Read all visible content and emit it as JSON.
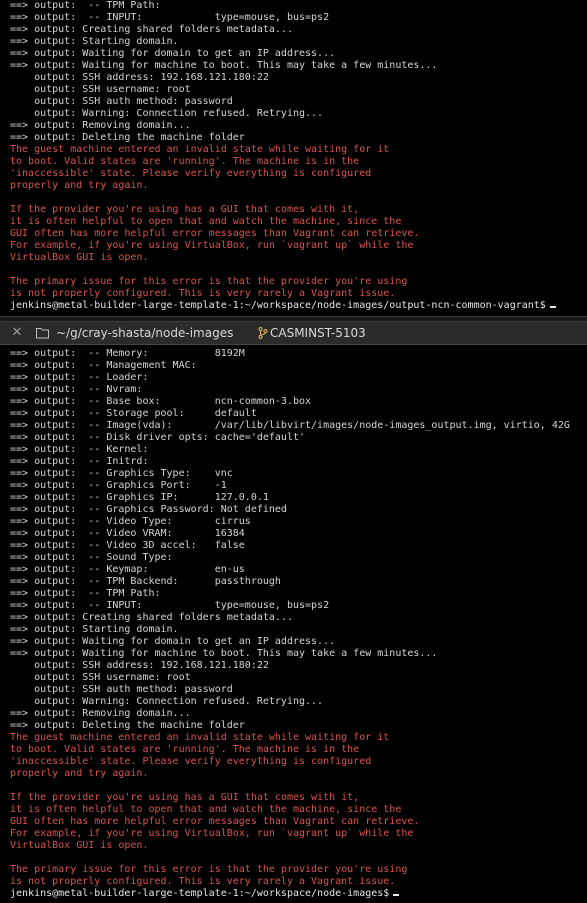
{
  "theme": {
    "background": "#000000",
    "text": "#d4d4d4",
    "error": "#d9534f"
  },
  "tab": {
    "close_icon": "close-icon",
    "folder_icon": "folder-icon",
    "path": "~/g/cray-shasta/node-images",
    "branch_icon": "git-branch-icon",
    "branch": "CASMINST-5103"
  },
  "top_pane": {
    "lines": [
      {
        "text": "==> output:  -- TPM Path:",
        "kind": "out"
      },
      {
        "text": "==> output:  -- INPUT:            type=mouse, bus=ps2",
        "kind": "out"
      },
      {
        "text": "==> output: Creating shared folders metadata...",
        "kind": "out"
      },
      {
        "text": "==> output: Starting domain.",
        "kind": "out"
      },
      {
        "text": "==> output: Waiting for domain to get an IP address...",
        "kind": "out"
      },
      {
        "text": "==> output: Waiting for machine to boot. This may take a few minutes...",
        "kind": "out"
      },
      {
        "text": "    output: SSH address: 192.168.121.180:22",
        "kind": "out"
      },
      {
        "text": "    output: SSH username: root",
        "kind": "out"
      },
      {
        "text": "    output: SSH auth method: password",
        "kind": "out"
      },
      {
        "text": "    output: Warning: Connection refused. Retrying...",
        "kind": "out"
      },
      {
        "text": "==> output: Removing domain...",
        "kind": "out"
      },
      {
        "text": "==> output: Deleting the machine folder",
        "kind": "out"
      },
      {
        "text": "The guest machine entered an invalid state while waiting for it",
        "kind": "err"
      },
      {
        "text": "to boot. Valid states are 'running'. The machine is in the",
        "kind": "err"
      },
      {
        "text": "'inaccessible' state. Please verify everything is configured",
        "kind": "err"
      },
      {
        "text": "properly and try again.",
        "kind": "err"
      },
      {
        "text": "",
        "kind": "err"
      },
      {
        "text": "If the provider you're using has a GUI that comes with it,",
        "kind": "err"
      },
      {
        "text": "it is often helpful to open that and watch the machine, since the",
        "kind": "err"
      },
      {
        "text": "GUI often has more helpful error messages than Vagrant can retrieve.",
        "kind": "err"
      },
      {
        "text": "For example, if you're using VirtualBox, run `vagrant up` while the",
        "kind": "err"
      },
      {
        "text": "VirtualBox GUI is open.",
        "kind": "err"
      },
      {
        "text": "",
        "kind": "err"
      },
      {
        "text": "The primary issue for this error is that the provider you're using",
        "kind": "err"
      },
      {
        "text": "is not properly configured. This is very rarely a Vagrant issue.",
        "kind": "err"
      }
    ],
    "prompt": "jenkins@metal-builder-large-template-1:~/workspace/node-images/output-ncn-common-vagrant$"
  },
  "bottom_pane": {
    "lines": [
      {
        "text": "==> output:  -- Memory:           8192M",
        "kind": "out"
      },
      {
        "text": "==> output:  -- Management MAC:",
        "kind": "out"
      },
      {
        "text": "==> output:  -- Loader:",
        "kind": "out"
      },
      {
        "text": "==> output:  -- Nvram:",
        "kind": "out"
      },
      {
        "text": "==> output:  -- Base box:         ncn-common-3.box",
        "kind": "out"
      },
      {
        "text": "==> output:  -- Storage pool:     default",
        "kind": "out"
      },
      {
        "text": "==> output:  -- Image(vda):       /var/lib/libvirt/images/node-images_output.img, virtio, 42G",
        "kind": "out"
      },
      {
        "text": "==> output:  -- Disk driver opts: cache='default'",
        "kind": "out"
      },
      {
        "text": "==> output:  -- Kernel:",
        "kind": "out"
      },
      {
        "text": "==> output:  -- Initrd:",
        "kind": "out"
      },
      {
        "text": "==> output:  -- Graphics Type:    vnc",
        "kind": "out"
      },
      {
        "text": "==> output:  -- Graphics Port:    -1",
        "kind": "out"
      },
      {
        "text": "==> output:  -- Graphics IP:      127.0.0.1",
        "kind": "out"
      },
      {
        "text": "==> output:  -- Graphics Password: Not defined",
        "kind": "out"
      },
      {
        "text": "==> output:  -- Video Type:       cirrus",
        "kind": "out"
      },
      {
        "text": "==> output:  -- Video VRAM:       16384",
        "kind": "out"
      },
      {
        "text": "==> output:  -- Video 3D accel:   false",
        "kind": "out"
      },
      {
        "text": "==> output:  -- Sound Type:",
        "kind": "out"
      },
      {
        "text": "==> output:  -- Keymap:           en-us",
        "kind": "out"
      },
      {
        "text": "==> output:  -- TPM Backend:      passthrough",
        "kind": "out"
      },
      {
        "text": "==> output:  -- TPM Path:",
        "kind": "out"
      },
      {
        "text": "==> output:  -- INPUT:            type=mouse, bus=ps2",
        "kind": "out"
      },
      {
        "text": "==> output: Creating shared folders metadata...",
        "kind": "out"
      },
      {
        "text": "==> output: Starting domain.",
        "kind": "out"
      },
      {
        "text": "==> output: Waiting for domain to get an IP address...",
        "kind": "out"
      },
      {
        "text": "==> output: Waiting for machine to boot. This may take a few minutes...",
        "kind": "out"
      },
      {
        "text": "    output: SSH address: 192.168.121.180:22",
        "kind": "out"
      },
      {
        "text": "    output: SSH username: root",
        "kind": "out"
      },
      {
        "text": "    output: SSH auth method: password",
        "kind": "out"
      },
      {
        "text": "    output: Warning: Connection refused. Retrying...",
        "kind": "out"
      },
      {
        "text": "==> output: Removing domain...",
        "kind": "out"
      },
      {
        "text": "==> output: Deleting the machine folder",
        "kind": "out"
      },
      {
        "text": "The guest machine entered an invalid state while waiting for it",
        "kind": "err"
      },
      {
        "text": "to boot. Valid states are 'running'. The machine is in the",
        "kind": "err"
      },
      {
        "text": "'inaccessible' state. Please verify everything is configured",
        "kind": "err"
      },
      {
        "text": "properly and try again.",
        "kind": "err"
      },
      {
        "text": "",
        "kind": "err"
      },
      {
        "text": "If the provider you're using has a GUI that comes with it,",
        "kind": "err"
      },
      {
        "text": "it is often helpful to open that and watch the machine, since the",
        "kind": "err"
      },
      {
        "text": "GUI often has more helpful error messages than Vagrant can retrieve.",
        "kind": "err"
      },
      {
        "text": "For example, if you're using VirtualBox, run `vagrant up` while the",
        "kind": "err"
      },
      {
        "text": "VirtualBox GUI is open.",
        "kind": "err"
      },
      {
        "text": "",
        "kind": "err"
      },
      {
        "text": "The primary issue for this error is that the provider you're using",
        "kind": "err"
      },
      {
        "text": "is not properly configured. This is very rarely a Vagrant issue.",
        "kind": "err"
      }
    ],
    "prompt": "jenkins@metal-builder-large-template-1:~/workspace/node-images$"
  }
}
